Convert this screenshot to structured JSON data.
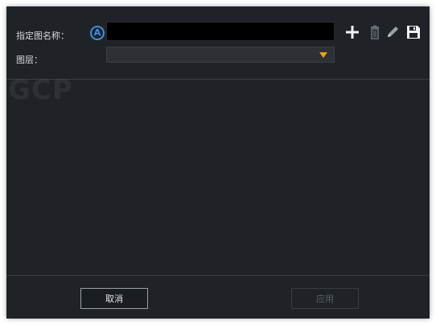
{
  "form": {
    "name_label": "指定图名称：",
    "name_badge": "A",
    "name_value": "",
    "type_label": "图层：",
    "type_value": ""
  },
  "toolbar": {
    "icons": [
      "plus-icon",
      "trash-icon",
      "pencil-icon",
      "floppy-disk-icon"
    ]
  },
  "watermark": "GCP",
  "footer": {
    "cancel_label": "取消",
    "apply_label": "应用"
  },
  "colors": {
    "dialog_bg": "#1f2328",
    "accent_blue": "#3d8ee8",
    "dropdown_arrow": "#e0a81c"
  }
}
